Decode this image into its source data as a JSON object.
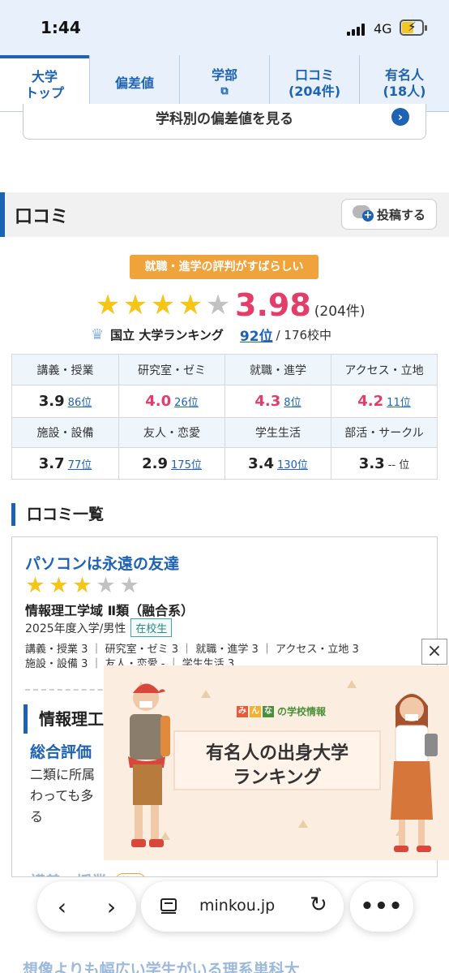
{
  "status_bar": {
    "time": "1:44",
    "network": "4G"
  },
  "tabs": [
    {
      "line1": "大学",
      "line2": "トップ"
    },
    {
      "line1": "偏差値",
      "line2": ""
    },
    {
      "line1": "学部",
      "line2": ""
    },
    {
      "line1": "口コミ",
      "line2": "(204件)"
    },
    {
      "line1": "有名人",
      "line2": "(18人)"
    }
  ],
  "deviation_button": {
    "label": "学科別の偏差値を見る"
  },
  "section": {
    "title": "口コミ",
    "post_button": "投稿する"
  },
  "summary": {
    "badge": "就職・進学の評判がすばらしい",
    "stars": 4,
    "score": "3.98",
    "count": "(204件)",
    "ranking_label": "国立 大学ランキング",
    "rank": "92位",
    "total": "/ 176校中"
  },
  "ratings": [
    {
      "label": "講義・授業",
      "score": "3.9",
      "rank": "86位",
      "highlight": false
    },
    {
      "label": "研究室・ゼミ",
      "score": "4.0",
      "rank": "26位",
      "highlight": true
    },
    {
      "label": "就職・進学",
      "score": "4.3",
      "rank": "8位",
      "highlight": true
    },
    {
      "label": "アクセス・立地",
      "score": "4.2",
      "rank": "11位",
      "highlight": true
    },
    {
      "label": "施設・設備",
      "score": "3.7",
      "rank": "77位",
      "highlight": false
    },
    {
      "label": "友人・恋愛",
      "score": "2.9",
      "rank": "175位",
      "highlight": false
    },
    {
      "label": "学生生活",
      "score": "3.4",
      "rank": "130位",
      "highlight": false
    },
    {
      "label": "部活・サークル",
      "score": "3.3",
      "rank": "-- 位",
      "highlight": false
    }
  ],
  "review_list": {
    "title": "口コミ一覧",
    "review": {
      "title": "パソコンは永遠の友達",
      "stars": 3,
      "department": "情報理工学域 Ⅱ類（融合系）",
      "meta": "2025年度入学/男性",
      "status_tag": "在校生",
      "scores_line1": "講義・授業 3 ｜ 研究室・ゼミ 3 ｜ 就職・進学 3 ｜ アクセス・立地 3",
      "scores_line2": "施設・設備 3 ｜ 友人・恋愛 - ｜ 学生生活 3",
      "sub_heading": "情報理工",
      "overall_label": "総合評価",
      "body_line1": "二類に所属",
      "body_line2": "わっても多",
      "body_line3": "る",
      "next_section": "講義・授業",
      "next_tag": "普通"
    },
    "next_review_title": "想像よりも幅広い学生がいる理系単科大"
  },
  "ad": {
    "logo_text": "の学校情報",
    "line1": "有名人の出身大学",
    "line2": "ランキング",
    "close": "×"
  },
  "browser": {
    "url": "minkou.jp"
  },
  "colors": {
    "accent": "#1d62b3",
    "highlight": "#e33d6a",
    "badge": "#f0a23b",
    "star": "#f5c518"
  }
}
